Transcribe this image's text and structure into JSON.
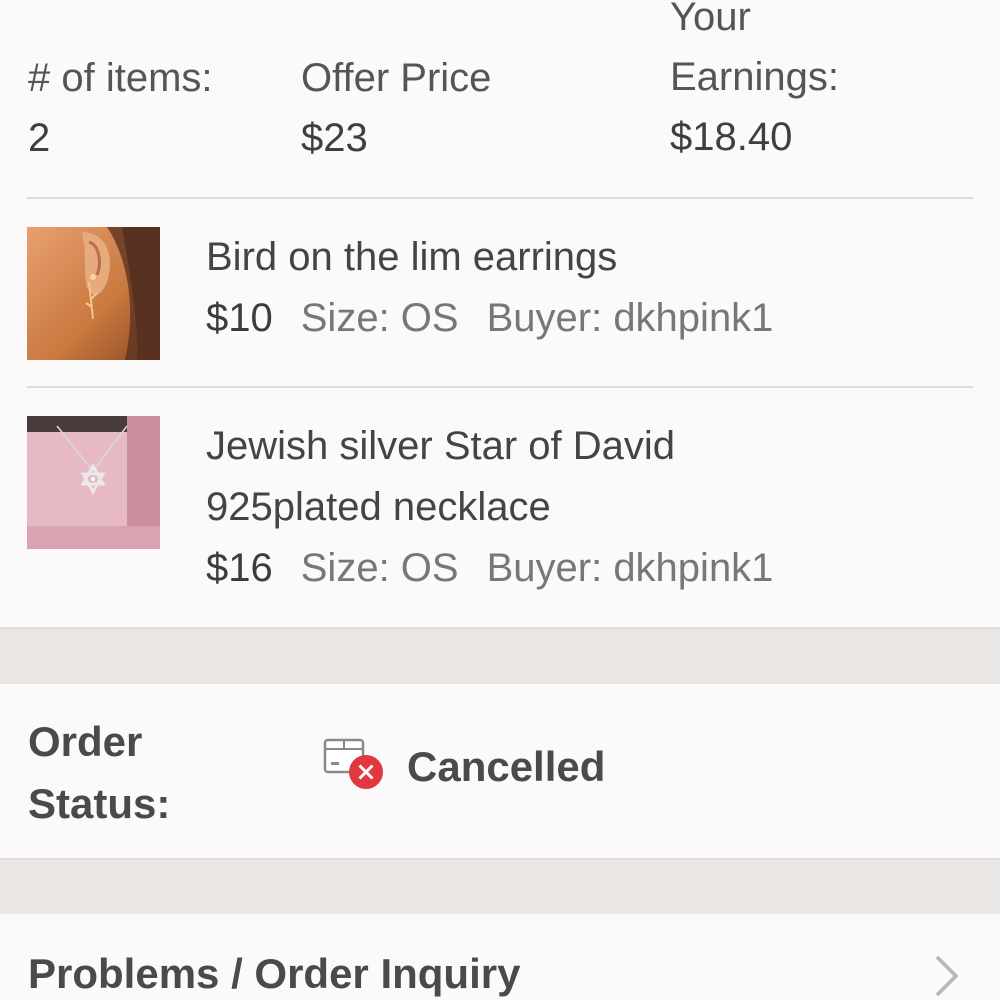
{
  "summary": {
    "items_label": "# of items:",
    "items_value": "2",
    "offer_label": "Offer Price",
    "offer_value": "$23",
    "earnings_label": "Your Earnings:",
    "earnings_value": "$18.40"
  },
  "items": [
    {
      "title": "Bird on the lim earrings",
      "price": "$10",
      "size": "Size: OS",
      "buyer": "Buyer: dkhpink1",
      "thumb_icon": "earring-photo"
    },
    {
      "title_line1": "Jewish silver Star of David",
      "title_line2": "925plated necklace",
      "price": "$16",
      "size": "Size: OS",
      "buyer": "Buyer: dkhpink1",
      "thumb_icon": "necklace-photo"
    }
  ],
  "order_status": {
    "label": "Order Status:",
    "value": "Cancelled",
    "icon": "package-cancelled-icon",
    "icon_color": "#e0383e"
  },
  "problems": {
    "label": "Problems / Order Inquiry",
    "icon": "chevron-right-icon"
  }
}
